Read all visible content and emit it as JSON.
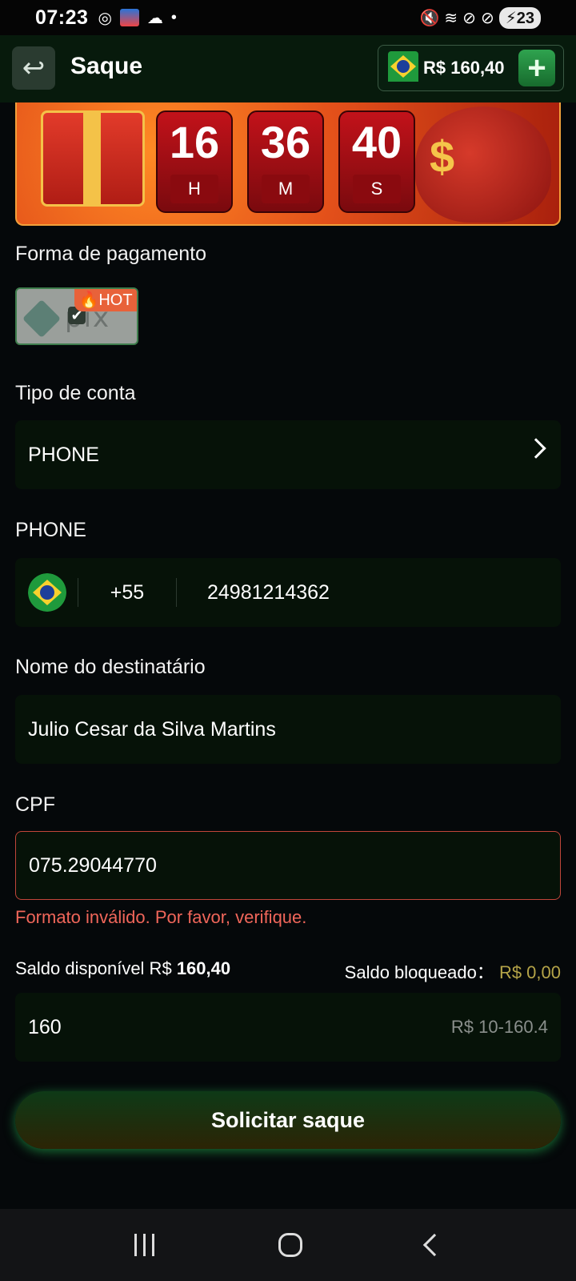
{
  "status_bar": {
    "time": "07:23",
    "battery": "23"
  },
  "header": {
    "title": "Saque",
    "balance": "R$ 160,40"
  },
  "banner": {
    "timer": [
      {
        "value": "16",
        "unit": "H"
      },
      {
        "value": "36",
        "unit": "M"
      },
      {
        "value": "40",
        "unit": "S"
      }
    ]
  },
  "payment": {
    "label": "Forma de pagamento",
    "method_name": "pix",
    "badge": "HOT"
  },
  "account_type": {
    "label": "Tipo de conta",
    "value": "PHONE"
  },
  "phone": {
    "label": "PHONE",
    "country_code": "+55",
    "number": "24981214362"
  },
  "recipient": {
    "label": "Nome do destinatário",
    "value": "Julio Cesar da Silva Martins"
  },
  "cpf": {
    "label": "CPF",
    "value": "075.29044770",
    "error": "Formato inválido. Por favor, verifique."
  },
  "saldo": {
    "available_label": "Saldo disponível R$",
    "available_value": "160,40",
    "blocked_label": "Saldo bloqueado：",
    "blocked_value": "R$ 0,00"
  },
  "amount": {
    "value": "160",
    "range_hint": "R$ 10-160.4"
  },
  "submit": {
    "label": "Solicitar saque"
  },
  "colors": {
    "error": "#f0665a",
    "accent_green": "#2fa34f",
    "blocked_gold": "#b5a448"
  }
}
